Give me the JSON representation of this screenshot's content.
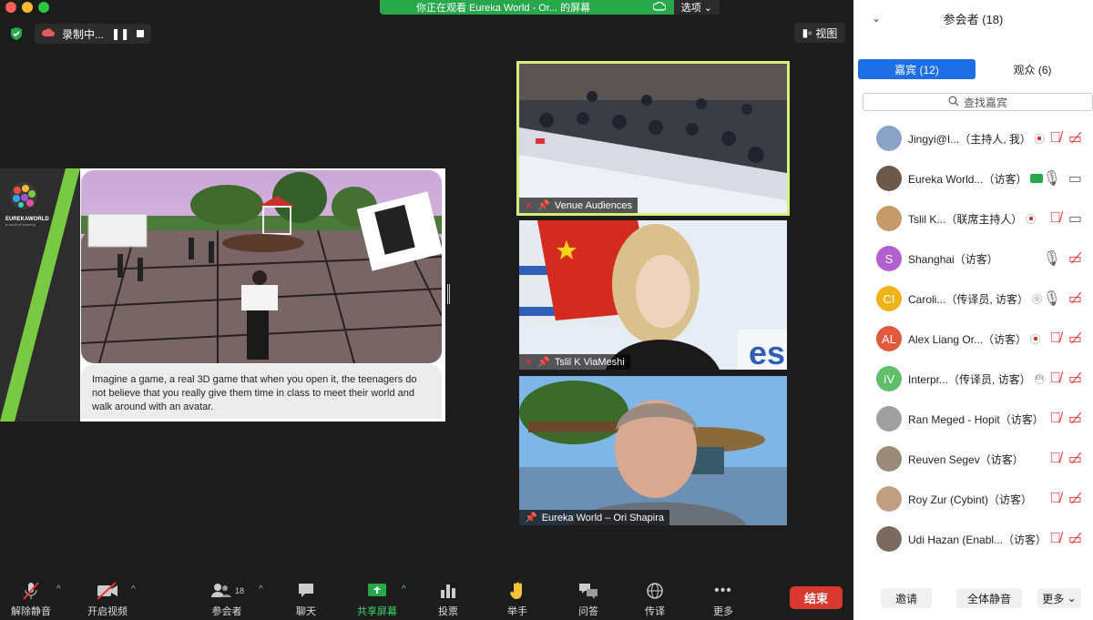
{
  "share_banner": {
    "text": "你正在观看 Eureka World - Or... 的屏幕",
    "options_label": "选项"
  },
  "recording": {
    "label": "录制中..."
  },
  "view_button": {
    "label": "视图"
  },
  "shared_content": {
    "brand": "EUREKAWORLD",
    "brand_sub": "a world of learning",
    "caption": "Imagine a game, a real 3D game that when you open it, the teenagers do not believe that you really give them time in class to meet their world and walk around with an avatar."
  },
  "video_tiles": [
    {
      "name": "Venue Audiences"
    },
    {
      "name": "Tslil K ViaMeshi"
    },
    {
      "name": "Eureka World – Ori Shapira"
    }
  ],
  "toolbar": {
    "unmute": "解除静音",
    "start_video": "开启视频",
    "participants": "参会者",
    "participants_count": "18",
    "chat": "聊天",
    "share": "共享屏幕",
    "poll": "投票",
    "raise_hand": "举手",
    "qa": "问答",
    "interpret": "传译",
    "more": "更多",
    "end": "结束"
  },
  "panel": {
    "title": "参会者 (18)",
    "tab_panelists": "嘉宾 (12)",
    "tab_attendees": "观众 (6)",
    "search_placeholder": "查找嘉宾",
    "participants": [
      {
        "name": "Jingyi@I...（主持人, 我）",
        "initials": "",
        "color": "#8aa4c8"
      },
      {
        "name": "Eureka World...（访客）",
        "initials": "",
        "color": "#6b5a4a"
      },
      {
        "name": "Tslil K...（联席主持人）",
        "initials": "",
        "color": "#c79a6a"
      },
      {
        "name": "Shanghai（访客）",
        "initials": "S",
        "color": "#b25fd0"
      },
      {
        "name": "Caroli...（传译员, 访客）",
        "initials": "CI",
        "color": "#f2b21b"
      },
      {
        "name": "Alex Liang Or...（访客）",
        "initials": "AL",
        "color": "#e05a3b"
      },
      {
        "name": "Interpr...（传译员, 访客）",
        "initials": "IV",
        "color": "#5fbf6a"
      },
      {
        "name": "Ran Meged - Hopit（访客）",
        "initials": "",
        "color": "#a0a0a0"
      },
      {
        "name": "Reuven Segev（访客）",
        "initials": "",
        "color": "#9a8a7a"
      },
      {
        "name": "Roy Zur (Cybint)（访客）",
        "initials": "",
        "color": "#c0a080"
      },
      {
        "name": "Udi Hazan (Enabl...（访客）",
        "initials": "",
        "color": "#7a6a60"
      }
    ],
    "interpreter_badge": "EN",
    "invite": "邀请",
    "mute_all": "全体静音",
    "more": "更多"
  }
}
